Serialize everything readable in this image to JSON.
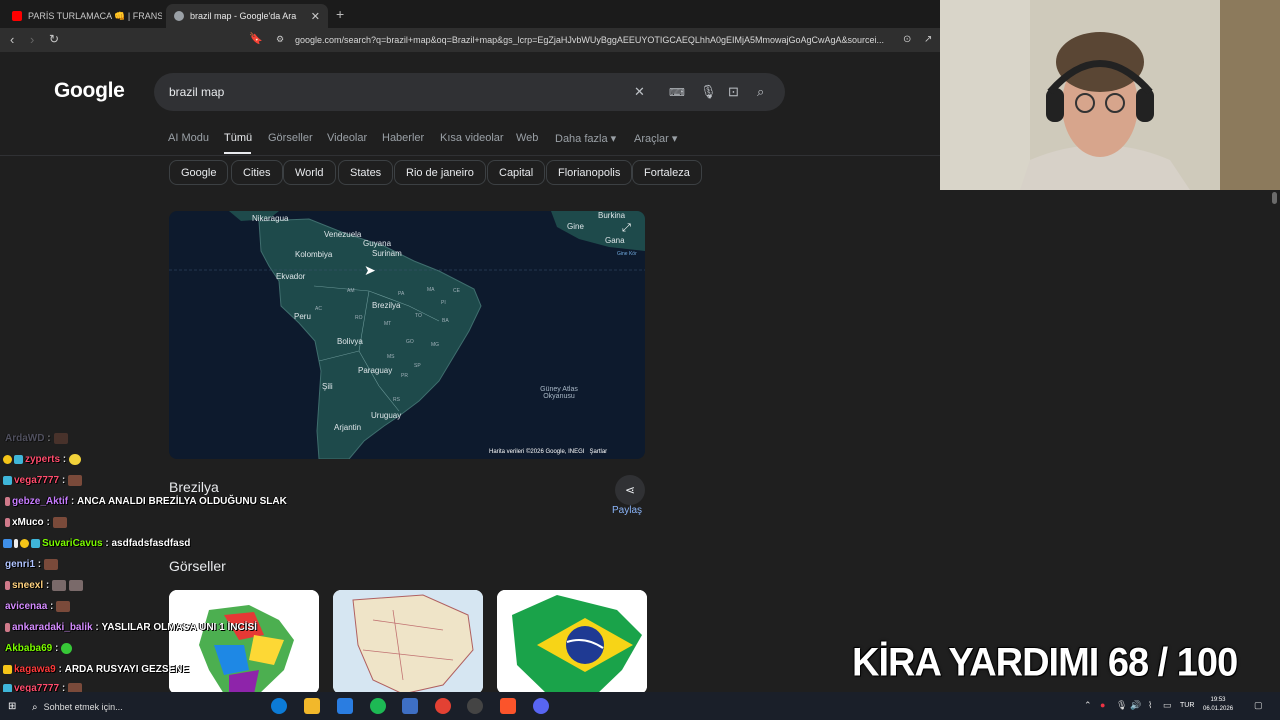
{
  "browser": {
    "tabs": [
      {
        "title": "PARİS TURLAMACA 👊 | FRANSA ! BA",
        "favicon_color": "#ff0000"
      },
      {
        "title": "brazil map - Google'da Ara",
        "favicon_color": "#9aa0a6"
      }
    ],
    "url": "google.com/search?q=brazil+map&oq=Brazil+map&gs_lcrp=EgZjaHJvbWUyBggAEEUYOTIGCAEQLhhA0gEIMjA5MmowajGoAgCwAgA&sourcei..."
  },
  "google": {
    "logo": "Google",
    "query": "brazil map",
    "tabs": [
      "AI Modu",
      "Tümü",
      "Görseller",
      "Videolar",
      "Haberler",
      "Kısa videolar",
      "Web",
      "Daha fazla ▾",
      "Araçlar ▾"
    ],
    "chips": [
      "Google",
      "Cities",
      "World",
      "States",
      "Rio de janeiro",
      "Capital",
      "Florianopolis",
      "Fortaleza"
    ],
    "map": {
      "labels": [
        "Nikaragua",
        "Venezuela",
        "Guyana",
        "Surinam",
        "Kolombiya",
        "Ekvador",
        "Brezilya",
        "Peru",
        "Bolivya",
        "Paraguay",
        "Şili",
        "Uruguay",
        "Arjantin",
        "Güney Atlas Okyanusu",
        "Burkina",
        "Gine",
        "Gana",
        "Gine Kör"
      ],
      "state_codes": [
        "AM",
        "PA",
        "MA",
        "CE",
        "RO",
        "MT",
        "TO",
        "BA",
        "GO",
        "MG",
        "MS",
        "SP",
        "PR",
        "RS",
        "PI",
        "AC"
      ],
      "credit": "Harita verileri ©2026 Google, INEGI",
      "terms": "Şartlar"
    },
    "place_title": "Brezilya",
    "share_label": "Paylaş",
    "images_heading": "Görseller"
  },
  "overlay": {
    "goal_text": "KİRA YARDIMI  68 / 100"
  },
  "chat": [
    {
      "user": "ArdaWD",
      "color": "#6b6b8a",
      "message": ""
    },
    {
      "user": "zyperts",
      "color": "#ff4d6d",
      "message": ""
    },
    {
      "user": "vega7777",
      "color": "#ff4d6d",
      "message": ""
    },
    {
      "user": "gebze_Aktif",
      "color": "#c77dff",
      "message": "ANCA ANALDI BREZİLYA OLDUĞUNU SLAK"
    },
    {
      "user": "xMuco",
      "color": "#ffffff",
      "message": ""
    },
    {
      "user": "SuvariCavus",
      "color": "#7cfc00",
      "message": "asdfadsfasdfasd"
    },
    {
      "user": "genri1",
      "color": "#b0c4ff",
      "message": ""
    },
    {
      "user": "sneexl",
      "color": "#ffd27f",
      "message": ""
    },
    {
      "user": "avicenaa",
      "color": "#d58cff",
      "message": ""
    },
    {
      "user": "ankaradaki_balik",
      "color": "#d58cff",
      "message": "YASLILAR OLMASA UNI 1 İNCİSİ"
    },
    {
      "user": "Akbaba69",
      "color": "#7cfc00",
      "message": ""
    },
    {
      "user": "kagawa9",
      "color": "#ff3b3b",
      "message": "ARDA RUSYAYI GEZSENE"
    },
    {
      "user": "vega7777",
      "color": "#ff4d6d",
      "message": ""
    }
  ],
  "taskbar": {
    "search_placeholder": "Sohbet etmek için...",
    "lang": "TUR",
    "time": "19:53",
    "date": "06.01.2026"
  }
}
